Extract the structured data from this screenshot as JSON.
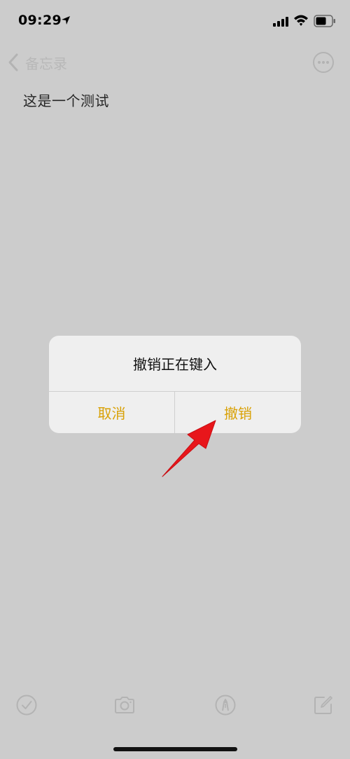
{
  "status_bar": {
    "time": "09:29",
    "icons": [
      "location-arrow-icon",
      "cellular-signal-icon",
      "wifi-icon",
      "battery-icon"
    ]
  },
  "nav": {
    "back_label": "备忘录",
    "back_icon": "chevron-left-icon",
    "more_icon": "ellipsis-circle-icon"
  },
  "note": {
    "body": "这是一个测试"
  },
  "alert": {
    "title": "撤销正在键入",
    "cancel_label": "取消",
    "undo_label": "撤销",
    "accent_color": "#d9a106"
  },
  "annotation": {
    "arrow_color": "#e8161b",
    "points_to": "undo"
  },
  "toolbar": {
    "icons": [
      "checklist-icon",
      "camera-icon",
      "markup-icon",
      "compose-icon"
    ]
  },
  "colors": {
    "background": "#cccccc",
    "alert_background": "#efefef"
  }
}
